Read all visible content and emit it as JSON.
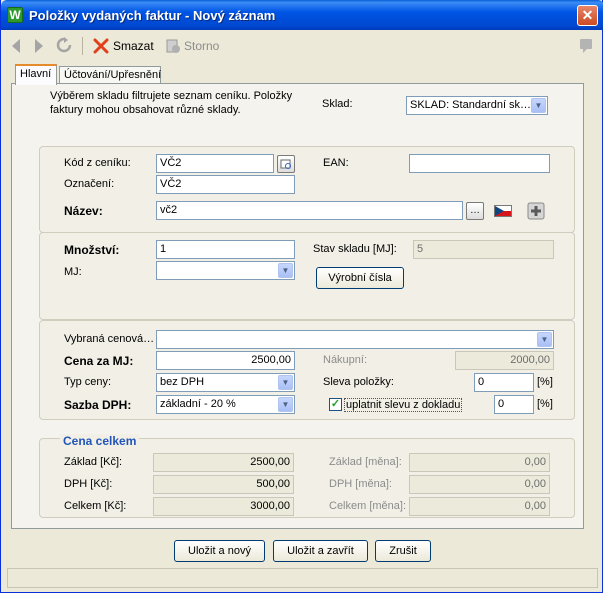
{
  "window": {
    "title": "Položky vydaných faktur - Nový záznam",
    "icon_letter": "W",
    "close_glyph": "✕"
  },
  "toolbar": {
    "delete_label": "Smazat",
    "cancel_label": "Storno"
  },
  "tabs": [
    {
      "label": "Hlavní"
    },
    {
      "label": "Účtování/Upřesnění"
    }
  ],
  "store": {
    "hint_line1": "Výběrem skladu filtrujete seznam ceníku. Položky",
    "hint_line2": "faktury mohou obsahovat různé sklady.",
    "label": "Sklad:",
    "value": "SKLAD: Standardní sk…"
  },
  "item": {
    "code_label": "Kód z ceníku:",
    "code_value": "VČ2",
    "ean_label": "EAN:",
    "ean_value": "",
    "designation_label": "Označení:",
    "designation_value": "VČ2",
    "name_label": "Název:",
    "name_value": "vč2",
    "ellipsis_btn": "…"
  },
  "quantity": {
    "qty_label": "Množství:",
    "qty_value": "1",
    "stock_label": "Stav skladu [MJ]:",
    "stock_value": "5",
    "unit_label": "MJ:",
    "unit_value": "",
    "serial_btn": "Výrobní čísla"
  },
  "pricing": {
    "pricelist_label": "Vybraná cenová…",
    "pricelist_value": "",
    "unit_price_label": "Cena za MJ:",
    "unit_price_value": "2500,00",
    "purchase_label": "Nákupní:",
    "purchase_value": "2000,00",
    "price_type_label": "Typ ceny:",
    "price_type_value": "bez DPH",
    "discount_label": "Sleva položky:",
    "discount_value": "0",
    "discount_unit": "[%]",
    "vat_label": "Sazba DPH:",
    "vat_value": "základní - 20 %",
    "apply_discount_label": "uplatnit slevu z dokladu",
    "apply_discount_value": "0",
    "apply_discount_unit": "[%]",
    "apply_discount_checked": true
  },
  "totals": {
    "title": "Cena celkem",
    "base_label": "Základ [Kč]:",
    "base_value": "2500,00",
    "vat_label": "DPH [Kč]:",
    "vat_value": "500,00",
    "total_label": "Celkem [Kč]:",
    "total_value": "3000,00",
    "base_cur_label": "Základ [měna]:",
    "base_cur_value": "0,00",
    "vat_cur_label": "DPH [měna]:",
    "vat_cur_value": "0,00",
    "total_cur_label": "Celkem [měna]:",
    "total_cur_value": "0,00"
  },
  "footer": {
    "save_new": "Uložit a nový",
    "save_close": "Uložit a zavřít",
    "cancel": "Zrušit"
  }
}
